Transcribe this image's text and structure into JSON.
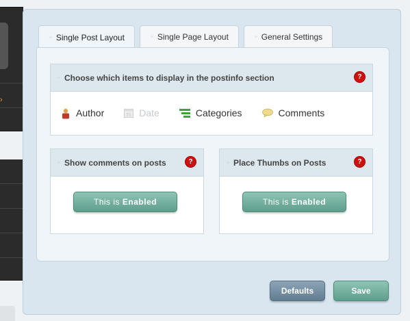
{
  "tabs": [
    {
      "label": "Single Post Layout",
      "active": true
    },
    {
      "label": "Single Page Layout",
      "active": false
    },
    {
      "label": "General Settings",
      "active": false
    }
  ],
  "postinfo": {
    "title": "Choose which items to display in the postinfo section",
    "help": "?",
    "items": [
      {
        "label": "Author",
        "icon": "author-icon",
        "enabled": true
      },
      {
        "label": "Date",
        "icon": "calendar-icon",
        "enabled": false
      },
      {
        "label": "Categories",
        "icon": "categories-icon",
        "enabled": true
      },
      {
        "label": "Comments",
        "icon": "comment-bubble-icon",
        "enabled": true
      }
    ]
  },
  "comments_box": {
    "title": "Show comments on posts",
    "help": "?",
    "button_prefix": "This is ",
    "button_state": "Enabled"
  },
  "thumbs_box": {
    "title": "Place Thumbs on Posts",
    "help": "?",
    "button_prefix": "This is ",
    "button_state": "Enabled"
  },
  "actions": {
    "defaults": "Defaults",
    "save": "Save"
  },
  "colors": {
    "help_badge": "#cc1111",
    "enabled_button": "#6fae9b",
    "defaults_button": "#7892a6",
    "author_icon": "#c0392b",
    "categories_icon": "#3aa635",
    "comments_icon": "#e8d47a"
  }
}
